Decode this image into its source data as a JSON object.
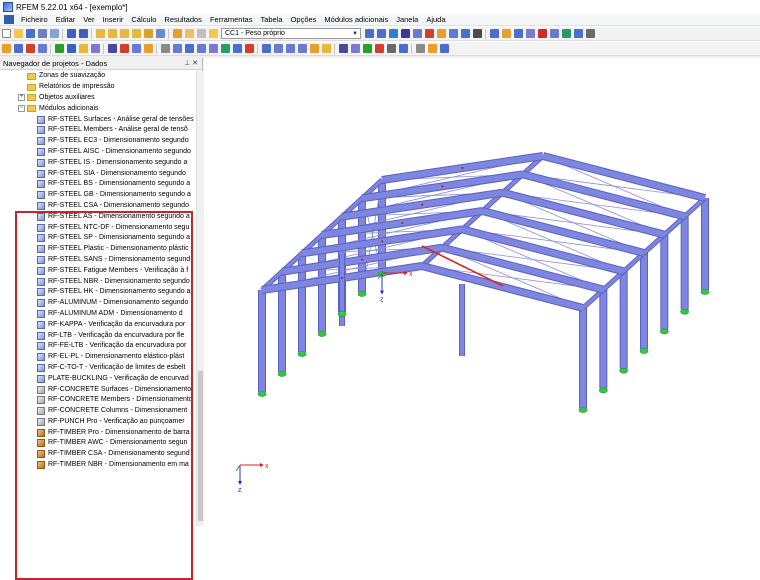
{
  "window": {
    "title": "RFEM 5.22.01 x64 - [exemplo*]"
  },
  "menu": [
    "Ficheiro",
    "Editar",
    "Ver",
    "Inserir",
    "Cálculo",
    "Resultados",
    "Ferramentas",
    "Tabela",
    "Opções",
    "Módulos adicionais",
    "Janela",
    "Ajuda"
  ],
  "toolbar": {
    "load_case": "CC1 - Peso próprio"
  },
  "navigator": {
    "title": "Navegador de projetos - Dados",
    "pin_controls": "⊥ ✕",
    "folders": [
      {
        "label": "Zonas de suavização"
      },
      {
        "label": "Relatórios de impressão"
      },
      {
        "label": "Objetos auxiliares",
        "expander": "+"
      },
      {
        "label": "Módulos adicionais",
        "expander": "−"
      }
    ],
    "modules": [
      "RF-STEEL Surfaces - Análise geral de tensões",
      "RF-STEEL Members - Análise geral de tensõ",
      "RF-STEEL EC3 - Dimensionamento segundo",
      "RF-STEEL AISC - Dimensionamento segundo",
      "RF-STEEL IS - Dimensionamento segundo a",
      "RF-STEEL SIA - Dimensionamento segundo",
      "RF-STEEL BS - Dimensionamento segundo a",
      "RF-STEEL GB - Dimensionamento segundo a",
      "RF-STEEL CSA - Dimensionamento segundo",
      "RF-STEEL AS - Dimensionamento segundo a",
      "RF-STEEL NTC-DF - Dimensionamento segu",
      "RF-STEEL SP - Dimensionamento segundo a",
      "RF-STEEL Plastic - Dimensionamento plástic",
      "RF-STEEL SANS - Dimensionamento segund",
      "RF-STEEL Fatigue Members - Verificação à f",
      "RF-STEEL NBR - Dimensionamento segundo",
      "RF-STEEL HK - Dimensionamento segundo a",
      "RF-ALUMINUM - Dimensionamento segundo",
      "RF-ALUMINUM ADM - Dimensionamento d",
      "RF-KAPPA - Verificação da encurvadura por",
      "RF-LTB - Verificação da encurvadura por fle",
      "RF-FE-LTB - Verificação da encurvadura por",
      "RF-EL-PL - Dimensionamento elástico-plást",
      "RF-C-TO-T - Verificação de limites de esbelt",
      "PLATE-BUCKLING - Verificação de encurvad",
      "RF-CONCRETE Surfaces - Dimensionamento",
      "RF-CONCRETE Members - Dimensionamento",
      "RF-CONCRETE Columns - Dimensionament",
      "RF-PUNCH Pro - Verificação ao punçoamer",
      "RF-TIMBER Pro - Dimensionamento de barra",
      "RF-TIMBER AWC - Dimensionamento segun",
      "RF-TIMBER CSA - Dimensionamento segund",
      "RF-TIMBER NBR - Dimensionamento em ma"
    ]
  },
  "axes": {
    "x": "x",
    "z": "z"
  },
  "colors": {
    "member": "#7f86df",
    "member_stroke": "#5a61c4",
    "support": "#2ecc40",
    "highlight": "#c0262c",
    "axis_x": "#d62424",
    "axis_z": "#2430c8",
    "axis_y": "#2aa02a"
  }
}
